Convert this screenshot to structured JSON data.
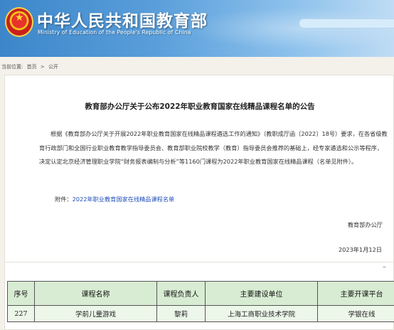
{
  "header": {
    "site_title": "中华人民共和国教育部",
    "site_subtitle": "Ministry of Education of the People's Republic of China"
  },
  "breadcrumb": {
    "prefix": "当前位置:",
    "home": "首页",
    "separator": ">",
    "current": "公开"
  },
  "article": {
    "title": "教育部办公厅关于公布2022年职业教育国家在线精品课程名单的公告",
    "body": "根据《教育部办公厅关于开展2022年职业教育国家在线精品课程遴选工作的通知》（教职成厅函〔2022〕18号）要求，在各省级教育行政部门和全国行业职业教育教学指导委员会、教育部职业院校教学（教育）指导委员会推荐的基础上，经专家遴选和公示等程序，决定认定北京经济管理职业学院“财务报表编制与分析”等1160门课程为2022年职业教育国家在线精品课程（名单见附件）。",
    "attachment_label": "附件：",
    "attachment_link": "2022年职业教育国家在线精品课程名单",
    "signature": "教育部办公厅",
    "date": "2023年1月12日"
  },
  "table": {
    "collapse_symbol": "–",
    "headers": [
      "序号",
      "课程名称",
      "课程负责人",
      "主要建设单位",
      "主要开课平台"
    ],
    "rows": [
      [
        "227",
        "学前儿童游戏",
        "黎莉",
        "上海工商职业技术学院",
        "学银在线"
      ]
    ]
  }
}
